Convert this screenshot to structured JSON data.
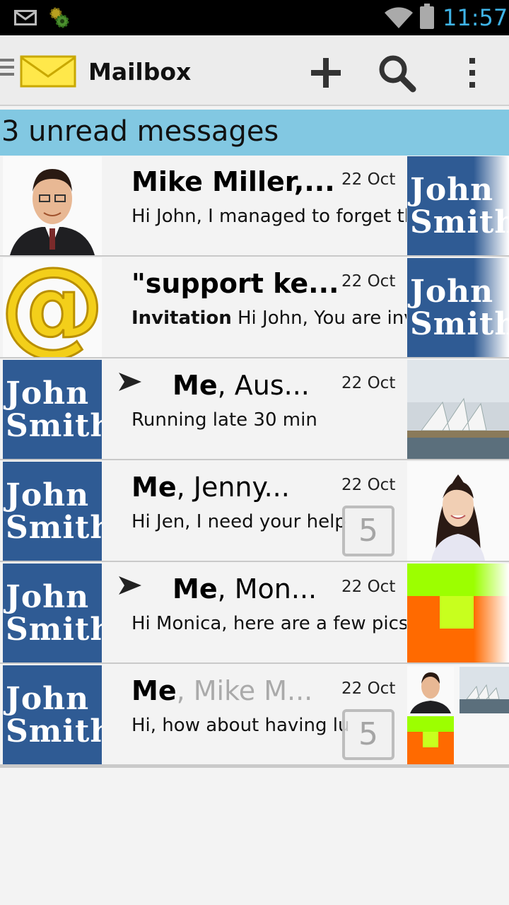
{
  "status_bar": {
    "time": "11:57"
  },
  "action_bar": {
    "title": "Mailbox"
  },
  "banner": {
    "text": "3 unread messages"
  },
  "avatar_text": {
    "line1": "John",
    "line2": "Smith"
  },
  "messages": [
    {
      "sender_bold": "Mike Miller,...",
      "sender_rest": "",
      "date": "22 Oct",
      "preview_bold": "",
      "preview": "Hi John, I managed to forget th",
      "state": "unread"
    },
    {
      "sender_bold": "\"support ke...",
      "sender_rest": "",
      "date": "22 Oct",
      "preview_bold": "Invitation",
      "preview": " Hi John, You are invi",
      "state": "unread"
    },
    {
      "sender_bold": "Me",
      "sender_rest": ", Aus...",
      "date": "22 Oct",
      "preview_bold": "",
      "preview": "Running late  30 min",
      "state": "read",
      "sent": true
    },
    {
      "sender_bold": "Me",
      "sender_rest": ", Jenny...",
      "date": "22 Oct",
      "preview_bold": "",
      "preview": "Hi Jen, I need your help",
      "state": "unread",
      "count": "5"
    },
    {
      "sender_bold": "Me",
      "sender_rest": ", Mon...",
      "date": "22 Oct",
      "preview_bold": "",
      "preview": "Hi Monica, here are a few pics",
      "state": "read",
      "sent": true
    },
    {
      "sender_bold": "Me",
      "sender_rest": ", Mike M...",
      "date": "22 Oct",
      "preview_bold": "",
      "preview": "Hi, how about having lu",
      "state": "read",
      "count": "5"
    }
  ]
}
